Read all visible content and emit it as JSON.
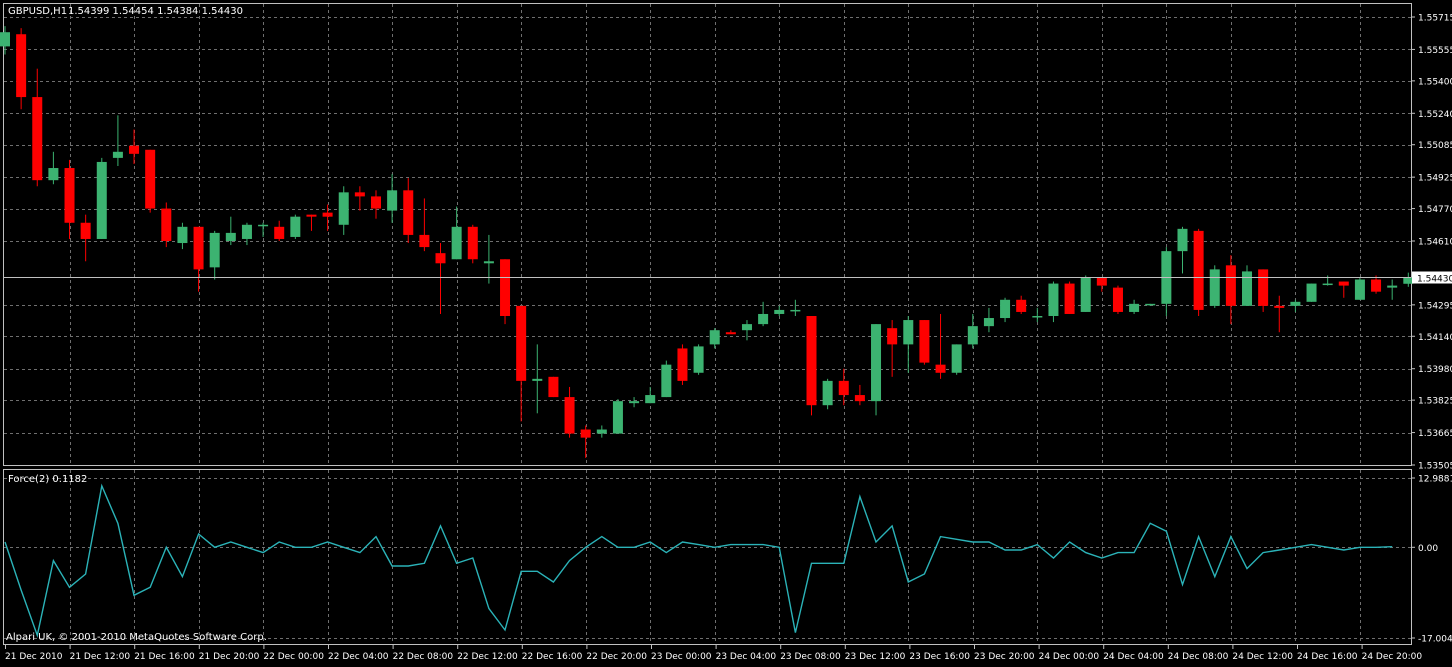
{
  "chart_header": {
    "symbol_label": "GBPUSD,H1",
    "ohlc_label": "1.54399 1.54454 1.54384 1.54430"
  },
  "indicator_header": {
    "label": "Force(2) 0.1182"
  },
  "copyright": "Alpari UK, © 2001-2010 MetaQuotes Software Corp.",
  "colors": {
    "background": "#000000",
    "grid": "#6f6f6f",
    "frame": "#c0c0c0",
    "bull": "#3cb371",
    "bear": "#ff0000",
    "force_line": "#2bb3b8",
    "text": "#ffffff",
    "current_price_box": "#ffffff",
    "current_price_text": "#000000"
  },
  "chart_data": [
    {
      "type": "candlestick",
      "title": "GBPUSD,H1",
      "y_ticks": [
        "1.55715",
        "1.55555",
        "1.55400",
        "1.55240",
        "1.55085",
        "1.54925",
        "1.54770",
        "1.54610",
        "1.54430",
        "1.54295",
        "1.54140",
        "1.53980",
        "1.53825",
        "1.53665",
        "1.53505"
      ],
      "ylim": [
        1.53505,
        1.55715
      ],
      "current_price": 1.5443,
      "x_ticks": [
        "21 Dec 2010",
        "21 Dec 12:00",
        "21 Dec 16:00",
        "21 Dec 20:00",
        "22 Dec 00:00",
        "22 Dec 04:00",
        "22 Dec 08:00",
        "22 Dec 12:00",
        "22 Dec 16:00",
        "22 Dec 20:00",
        "23 Dec 00:00",
        "23 Dec 04:00",
        "23 Dec 08:00",
        "23 Dec 12:00",
        "23 Dec 16:00",
        "23 Dec 20:00",
        "24 Dec 00:00",
        "24 Dec 04:00",
        "24 Dec 08:00",
        "24 Dec 12:00",
        "24 Dec 16:00",
        "24 Dec 20:00"
      ],
      "grid": true,
      "candles": [
        {
          "o": 1.5557,
          "h": 1.5567,
          "l": 1.5553,
          "c": 1.5564
        },
        {
          "o": 1.5563,
          "h": 1.5566,
          "l": 1.5526,
          "c": 1.5532
        },
        {
          "o": 1.5532,
          "h": 1.5546,
          "l": 1.5488,
          "c": 1.5491
        },
        {
          "o": 1.5491,
          "h": 1.5505,
          "l": 1.5489,
          "c": 1.5497
        },
        {
          "o": 1.5497,
          "h": 1.5501,
          "l": 1.5462,
          "c": 1.547
        },
        {
          "o": 1.547,
          "h": 1.5474,
          "l": 1.5451,
          "c": 1.5462
        },
        {
          "o": 1.5462,
          "h": 1.5502,
          "l": 1.5462,
          "c": 1.55
        },
        {
          "o": 1.5502,
          "h": 1.5523,
          "l": 1.5498,
          "c": 1.5505
        },
        {
          "o": 1.5508,
          "h": 1.5516,
          "l": 1.5499,
          "c": 1.5504
        },
        {
          "o": 1.5506,
          "h": 1.5506,
          "l": 1.5475,
          "c": 1.5477
        },
        {
          "o": 1.5477,
          "h": 1.548,
          "l": 1.5458,
          "c": 1.5461
        },
        {
          "o": 1.546,
          "h": 1.547,
          "l": 1.5457,
          "c": 1.5468
        },
        {
          "o": 1.5468,
          "h": 1.5468,
          "l": 1.5436,
          "c": 1.5447
        },
        {
          "o": 1.5448,
          "h": 1.5466,
          "l": 1.5442,
          "c": 1.5465
        },
        {
          "o": 1.5461,
          "h": 1.5473,
          "l": 1.5459,
          "c": 1.5465
        },
        {
          "o": 1.5462,
          "h": 1.547,
          "l": 1.5459,
          "c": 1.5469
        },
        {
          "o": 1.5469,
          "h": 1.547,
          "l": 1.5463,
          "c": 1.5469
        },
        {
          "o": 1.5468,
          "h": 1.5471,
          "l": 1.5461,
          "c": 1.5462
        },
        {
          "o": 1.5463,
          "h": 1.5474,
          "l": 1.5462,
          "c": 1.5473
        },
        {
          "o": 1.5474,
          "h": 1.5474,
          "l": 1.5466,
          "c": 1.5473
        },
        {
          "o": 1.5475,
          "h": 1.5479,
          "l": 1.5466,
          "c": 1.5473
        },
        {
          "o": 1.5469,
          "h": 1.5488,
          "l": 1.5464,
          "c": 1.5485
        },
        {
          "o": 1.5485,
          "h": 1.5488,
          "l": 1.5476,
          "c": 1.5483
        },
        {
          "o": 1.5483,
          "h": 1.5486,
          "l": 1.5472,
          "c": 1.5477
        },
        {
          "o": 1.5476,
          "h": 1.5494,
          "l": 1.547,
          "c": 1.5486
        },
        {
          "o": 1.5486,
          "h": 1.5492,
          "l": 1.546,
          "c": 1.5464
        },
        {
          "o": 1.5464,
          "h": 1.5482,
          "l": 1.5456,
          "c": 1.5458
        },
        {
          "o": 1.5455,
          "h": 1.546,
          "l": 1.5425,
          "c": 1.545
        },
        {
          "o": 1.5452,
          "h": 1.5478,
          "l": 1.5452,
          "c": 1.5468
        },
        {
          "o": 1.5468,
          "h": 1.5469,
          "l": 1.545,
          "c": 1.5452
        },
        {
          "o": 1.545,
          "h": 1.5464,
          "l": 1.544,
          "c": 1.5451
        },
        {
          "o": 1.5452,
          "h": 1.5452,
          "l": 1.542,
          "c": 1.5424
        },
        {
          "o": 1.5429,
          "h": 1.5429,
          "l": 1.5372,
          "c": 1.5392
        },
        {
          "o": 1.5392,
          "h": 1.541,
          "l": 1.5376,
          "c": 1.5393
        },
        {
          "o": 1.5394,
          "h": 1.5394,
          "l": 1.5384,
          "c": 1.5384
        },
        {
          "o": 1.5384,
          "h": 1.5389,
          "l": 1.5364,
          "c": 1.5366
        },
        {
          "o": 1.5368,
          "h": 1.537,
          "l": 1.5354,
          "c": 1.5364
        },
        {
          "o": 1.5366,
          "h": 1.537,
          "l": 1.5364,
          "c": 1.5368
        },
        {
          "o": 1.5366,
          "h": 1.5383,
          "l": 1.5366,
          "c": 1.5382
        },
        {
          "o": 1.5381,
          "h": 1.5384,
          "l": 1.5379,
          "c": 1.5382
        },
        {
          "o": 1.5381,
          "h": 1.5389,
          "l": 1.5381,
          "c": 1.5385
        },
        {
          "o": 1.5384,
          "h": 1.5402,
          "l": 1.5384,
          "c": 1.54
        },
        {
          "o": 1.5408,
          "h": 1.541,
          "l": 1.539,
          "c": 1.5392
        },
        {
          "o": 1.5396,
          "h": 1.541,
          "l": 1.5395,
          "c": 1.5409
        },
        {
          "o": 1.541,
          "h": 1.5418,
          "l": 1.5408,
          "c": 1.5417
        },
        {
          "o": 1.5416,
          "h": 1.5417,
          "l": 1.5416,
          "c": 1.5415
        },
        {
          "o": 1.5417,
          "h": 1.5422,
          "l": 1.5412,
          "c": 1.542
        },
        {
          "o": 1.542,
          "h": 1.5431,
          "l": 1.5419,
          "c": 1.5425
        },
        {
          "o": 1.5425,
          "h": 1.5429,
          "l": 1.5424,
          "c": 1.5427
        },
        {
          "o": 1.5427,
          "h": 1.5432,
          "l": 1.5424,
          "c": 1.5427
        },
        {
          "o": 1.5424,
          "h": 1.5424,
          "l": 1.5375,
          "c": 1.538
        },
        {
          "o": 1.538,
          "h": 1.5393,
          "l": 1.5378,
          "c": 1.5392
        },
        {
          "o": 1.5392,
          "h": 1.5398,
          "l": 1.538,
          "c": 1.5385
        },
        {
          "o": 1.5385,
          "h": 1.539,
          "l": 1.538,
          "c": 1.5382
        },
        {
          "o": 1.5382,
          "h": 1.542,
          "l": 1.5375,
          "c": 1.542
        },
        {
          "o": 1.5418,
          "h": 1.5422,
          "l": 1.5394,
          "c": 1.541
        },
        {
          "o": 1.541,
          "h": 1.5424,
          "l": 1.5396,
          "c": 1.5422
        },
        {
          "o": 1.5422,
          "h": 1.5422,
          "l": 1.54,
          "c": 1.5401
        },
        {
          "o": 1.54,
          "h": 1.5425,
          "l": 1.5393,
          "c": 1.5396
        },
        {
          "o": 1.5396,
          "h": 1.541,
          "l": 1.5395,
          "c": 1.541
        },
        {
          "o": 1.541,
          "h": 1.5425,
          "l": 1.5408,
          "c": 1.5419
        },
        {
          "o": 1.5419,
          "h": 1.5428,
          "l": 1.5416,
          "c": 1.5423
        },
        {
          "o": 1.5423,
          "h": 1.5433,
          "l": 1.5421,
          "c": 1.5432
        },
        {
          "o": 1.5432,
          "h": 1.5434,
          "l": 1.5425,
          "c": 1.5426
        },
        {
          "o": 1.5424,
          "h": 1.5428,
          "l": 1.5421,
          "c": 1.5424
        },
        {
          "o": 1.5424,
          "h": 1.5441,
          "l": 1.5421,
          "c": 1.544
        },
        {
          "o": 1.544,
          "h": 1.5441,
          "l": 1.5425,
          "c": 1.5425
        },
        {
          "o": 1.5426,
          "h": 1.5444,
          "l": 1.5426,
          "c": 1.5443
        },
        {
          "o": 1.5443,
          "h": 1.5443,
          "l": 1.5436,
          "c": 1.5439
        },
        {
          "o": 1.5438,
          "h": 1.5439,
          "l": 1.5425,
          "c": 1.5426
        },
        {
          "o": 1.5426,
          "h": 1.5432,
          "l": 1.5425,
          "c": 1.543
        },
        {
          "o": 1.543,
          "h": 1.543,
          "l": 1.5429,
          "c": 1.543
        },
        {
          "o": 1.543,
          "h": 1.5458,
          "l": 1.5424,
          "c": 1.5456
        },
        {
          "o": 1.5456,
          "h": 1.5468,
          "l": 1.5445,
          "c": 1.5467
        },
        {
          "o": 1.5466,
          "h": 1.5467,
          "l": 1.5424,
          "c": 1.5427
        },
        {
          "o": 1.5429,
          "h": 1.5449,
          "l": 1.5428,
          "c": 1.5447
        },
        {
          "o": 1.5449,
          "h": 1.5454,
          "l": 1.542,
          "c": 1.5429
        },
        {
          "o": 1.5429,
          "h": 1.5449,
          "l": 1.5429,
          "c": 1.5446
        },
        {
          "o": 1.5447,
          "h": 1.5447,
          "l": 1.5426,
          "c": 1.5429
        },
        {
          "o": 1.5429,
          "h": 1.5434,
          "l": 1.5416,
          "c": 1.5428
        },
        {
          "o": 1.5429,
          "h": 1.5432,
          "l": 1.5426,
          "c": 1.5431
        },
        {
          "o": 1.5431,
          "h": 1.544,
          "l": 1.5431,
          "c": 1.544
        },
        {
          "o": 1.544,
          "h": 1.5444,
          "l": 1.5439,
          "c": 1.544
        },
        {
          "o": 1.5441,
          "h": 1.5441,
          "l": 1.5433,
          "c": 1.5439
        },
        {
          "o": 1.5432,
          "h": 1.5443,
          "l": 1.5432,
          "c": 1.5442
        },
        {
          "o": 1.5442,
          "h": 1.5444,
          "l": 1.5435,
          "c": 1.5436
        },
        {
          "o": 1.5438,
          "h": 1.5442,
          "l": 1.5432,
          "c": 1.5439
        },
        {
          "o": 1.54399,
          "h": 1.54454,
          "l": 1.54384,
          "c": 1.5443
        }
      ]
    },
    {
      "type": "line",
      "title": "Force(2) 0.1182",
      "y_ticks": [
        "12.9881",
        "0.00",
        "-17.004"
      ],
      "ylim": [
        -17.004,
        12.9881
      ],
      "series": [
        {
          "values": [
            1.0,
            -8.0,
            -16.5,
            -2.5,
            -7.5,
            -5.0,
            11.5,
            4.5,
            -9.0,
            -7.5,
            0.0,
            -5.5,
            2.5,
            0.0,
            1.0,
            0.0,
            -1.0,
            1.0,
            0.0,
            0.0,
            1.0,
            0.0,
            -1.0,
            2.0,
            -3.5,
            -3.5,
            -3.0,
            4.0,
            -3.0,
            -2.0,
            -11.5,
            -15.5,
            -4.5,
            -4.5,
            -6.5,
            -2.5,
            0.0,
            2.0,
            0.0,
            0.0,
            1.0,
            -1.0,
            1.0,
            0.5,
            0.0,
            0.5,
            0.5,
            0.5,
            0.0,
            -16.0,
            -3.0,
            -3.0,
            -3.0,
            9.5,
            1.0,
            4.0,
            -6.5,
            -5.0,
            2.0,
            1.5,
            1.0,
            1.0,
            -0.5,
            -0.5,
            0.5,
            -2.0,
            1.0,
            -1.0,
            -2.0,
            -1.0,
            -1.0,
            4.5,
            3.0,
            -7.0,
            2.0,
            -5.5,
            2.0,
            -4.0,
            -1.0,
            -0.5,
            0.0,
            0.5,
            0.0,
            -0.5,
            0.0,
            0.0,
            0.1182
          ]
        }
      ]
    }
  ]
}
